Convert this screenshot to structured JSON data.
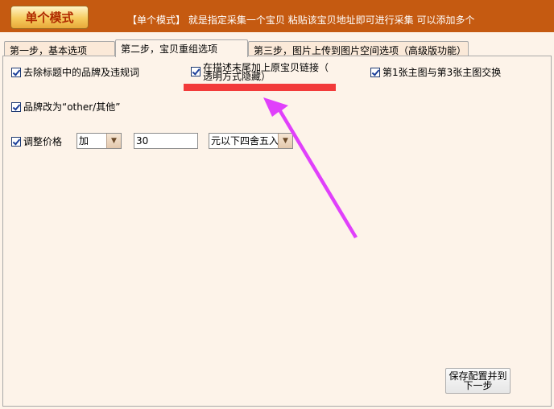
{
  "header": {
    "mode_button": "单个模式",
    "description": "【单个模式】 就是指定采集一个宝贝 粘贴该宝贝地址即可进行采集 可以添加多个"
  },
  "tabs": [
    {
      "label": "第一步，基本选项",
      "active": false
    },
    {
      "label": "第二步，宝贝重组选项",
      "active": true
    },
    {
      "label": "第三步，图片上传到图片空间选项（高级版功能）",
      "active": false
    }
  ],
  "options": {
    "remove_brand": {
      "label": "去除标题中的品牌及违规词",
      "checked": true
    },
    "append_link": {
      "label_line1": "在描述末尾加上原宝贝链接（",
      "label_line2": "透明方式隐藏）",
      "checked": true
    },
    "swap_images": {
      "label": "第1张主图与第3张主图交换",
      "checked": true
    },
    "brand_other": {
      "label": "品牌改为“other/其他”",
      "checked": true
    },
    "adjust_price": {
      "label": "调整价格",
      "checked": true
    }
  },
  "price": {
    "operation": "加",
    "amount": "30",
    "rounding": "元以下四舍五入"
  },
  "save_button": "保存配置并到\n下一步",
  "colors": {
    "header_bg": "#c55a11",
    "annotation_underline": "#f23a3a",
    "annotation_arrow": "#e040fb"
  }
}
